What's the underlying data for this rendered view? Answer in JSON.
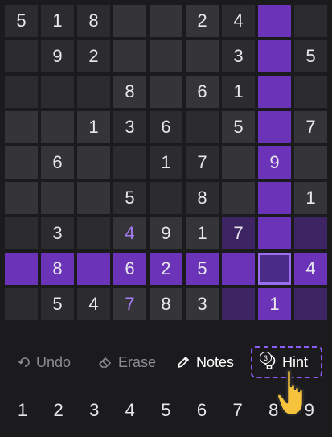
{
  "board": {
    "rows": [
      [
        "5",
        "1",
        "8",
        "",
        "",
        "2",
        "4",
        "",
        ""
      ],
      [
        "",
        "9",
        "2",
        "",
        "",
        "",
        "3",
        "",
        "5"
      ],
      [
        "",
        "",
        "",
        "8",
        "",
        "6",
        "1",
        "",
        ""
      ],
      [
        "",
        "",
        "1",
        "3",
        "6",
        "",
        "5",
        "",
        "7"
      ],
      [
        "",
        "6",
        "",
        "",
        "1",
        "7",
        "",
        "9",
        ""
      ],
      [
        "",
        "",
        "",
        "5",
        "",
        "8",
        "",
        "",
        "1"
      ],
      [
        "",
        "3",
        "",
        "4",
        "9",
        "1",
        "7",
        "",
        ""
      ],
      [
        "",
        "8",
        "",
        "6",
        "2",
        "5",
        "",
        "",
        "4"
      ],
      [
        "",
        "5",
        "4",
        "7",
        "8",
        "3",
        "",
        "1",
        ""
      ]
    ],
    "user_entries": [
      [
        6,
        3
      ],
      [
        8,
        3
      ]
    ],
    "selected": [
      7,
      7
    ],
    "highlight_color": "#6a33b8",
    "user_digit_color": "#a77cf7"
  },
  "toolbar": {
    "undo_label": "Undo",
    "erase_label": "Erase",
    "notes_label": "Notes",
    "hint_label": "Hint",
    "hint_count": "3",
    "icons": [
      "undo-icon",
      "eraser-icon",
      "pencil-icon",
      "lightbulb-icon"
    ]
  },
  "numpad": [
    "1",
    "2",
    "3",
    "4",
    "5",
    "6",
    "7",
    "8",
    "9"
  ]
}
